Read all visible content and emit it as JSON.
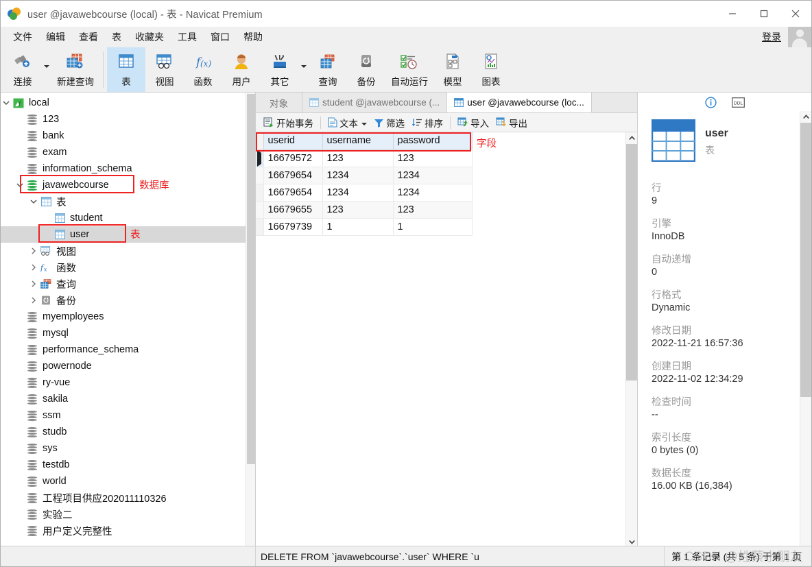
{
  "window": {
    "title": "user @javawebcourse (local) - 表 - Navicat Premium",
    "minimize": "—",
    "maximize": "□",
    "close": "✕"
  },
  "menubar": {
    "items": [
      "文件",
      "编辑",
      "查看",
      "表",
      "收藏夹",
      "工具",
      "窗口",
      "帮助"
    ],
    "login_label": "登录"
  },
  "toolbar": {
    "items": [
      {
        "label": "连接",
        "icon": "connection-icon",
        "has_caret": true,
        "active": false
      },
      {
        "label": "新建查询",
        "icon": "new-query-icon",
        "has_caret": false,
        "active": false
      },
      {
        "label": "表",
        "icon": "table-icon",
        "has_caret": false,
        "active": true
      },
      {
        "label": "视图",
        "icon": "view-icon",
        "has_caret": false,
        "active": false
      },
      {
        "label": "函数",
        "icon": "function-icon",
        "has_caret": false,
        "active": false
      },
      {
        "label": "用户",
        "icon": "user-icon",
        "has_caret": false,
        "active": false
      },
      {
        "label": "其它",
        "icon": "other-icon",
        "has_caret": true,
        "active": false
      },
      {
        "label": "查询",
        "icon": "query-icon",
        "has_caret": false,
        "active": false
      },
      {
        "label": "备份",
        "icon": "backup-icon",
        "has_caret": false,
        "active": false
      },
      {
        "label": "自动运行",
        "icon": "automation-icon",
        "has_caret": false,
        "active": false
      },
      {
        "label": "模型",
        "icon": "model-icon",
        "has_caret": false,
        "active": false
      },
      {
        "label": "图表",
        "icon": "chart-icon",
        "has_caret": false,
        "active": false
      }
    ]
  },
  "sidebar": {
    "tree": [
      {
        "label": "local",
        "icon": "mysql-connection-icon",
        "indent": 0,
        "twisty": "down",
        "selected": false
      },
      {
        "label": "123",
        "icon": "database-icon",
        "indent": 1,
        "twisty": "none",
        "selected": false
      },
      {
        "label": "bank",
        "icon": "database-icon",
        "indent": 1,
        "twisty": "none",
        "selected": false
      },
      {
        "label": "exam",
        "icon": "database-icon",
        "indent": 1,
        "twisty": "none",
        "selected": false
      },
      {
        "label": "information_schema",
        "icon": "database-icon",
        "indent": 1,
        "twisty": "none",
        "selected": false
      },
      {
        "label": "javawebcourse",
        "icon": "database-active-icon",
        "indent": 1,
        "twisty": "down",
        "selected": false
      },
      {
        "label": "表",
        "icon": "tables-folder-icon",
        "indent": 2,
        "twisty": "down",
        "selected": false
      },
      {
        "label": "student",
        "icon": "table-item-icon",
        "indent": 3,
        "twisty": "none",
        "selected": false
      },
      {
        "label": "user",
        "icon": "table-item-icon",
        "indent": 3,
        "twisty": "none",
        "selected": true
      },
      {
        "label": "视图",
        "icon": "views-folder-icon",
        "indent": 2,
        "twisty": "right",
        "selected": false
      },
      {
        "label": "函数",
        "icon": "functions-folder-icon",
        "indent": 2,
        "twisty": "right",
        "selected": false
      },
      {
        "label": "查询",
        "icon": "queries-folder-icon",
        "indent": 2,
        "twisty": "right",
        "selected": false
      },
      {
        "label": "备份",
        "icon": "backups-folder-icon",
        "indent": 2,
        "twisty": "right",
        "selected": false
      },
      {
        "label": "myemployees",
        "icon": "database-icon",
        "indent": 1,
        "twisty": "none",
        "selected": false
      },
      {
        "label": "mysql",
        "icon": "database-icon",
        "indent": 1,
        "twisty": "none",
        "selected": false
      },
      {
        "label": "performance_schema",
        "icon": "database-icon",
        "indent": 1,
        "twisty": "none",
        "selected": false
      },
      {
        "label": "powernode",
        "icon": "database-icon",
        "indent": 1,
        "twisty": "none",
        "selected": false
      },
      {
        "label": "ry-vue",
        "icon": "database-icon",
        "indent": 1,
        "twisty": "none",
        "selected": false
      },
      {
        "label": "sakila",
        "icon": "database-icon",
        "indent": 1,
        "twisty": "none",
        "selected": false
      },
      {
        "label": "ssm",
        "icon": "database-icon",
        "indent": 1,
        "twisty": "none",
        "selected": false
      },
      {
        "label": "studb",
        "icon": "database-icon",
        "indent": 1,
        "twisty": "none",
        "selected": false
      },
      {
        "label": "sys",
        "icon": "database-icon",
        "indent": 1,
        "twisty": "none",
        "selected": false
      },
      {
        "label": "testdb",
        "icon": "database-icon",
        "indent": 1,
        "twisty": "none",
        "selected": false
      },
      {
        "label": "world",
        "icon": "database-icon",
        "indent": 1,
        "twisty": "none",
        "selected": false
      },
      {
        "label": "工程项目供应202011110326",
        "icon": "database-icon",
        "indent": 1,
        "twisty": "none",
        "selected": false
      },
      {
        "label": "实验二",
        "icon": "database-icon",
        "indent": 1,
        "twisty": "none",
        "selected": false
      },
      {
        "label": "用户定义完整性",
        "icon": "database-icon",
        "indent": 1,
        "twisty": "none",
        "selected": false
      }
    ]
  },
  "annotations": [
    {
      "name": "database-annotation",
      "text": "数据库"
    },
    {
      "name": "table-annotation",
      "text": "表"
    },
    {
      "name": "field-annotation",
      "text": "字段"
    }
  ],
  "tabs": [
    {
      "label": "对象",
      "icon": "none",
      "active": false
    },
    {
      "label": "student @javawebcourse (...",
      "icon": "table-item-icon",
      "active": false
    },
    {
      "label": "user @javawebcourse (loc...",
      "icon": "table-item-icon",
      "active": true
    }
  ],
  "subtoolbar": {
    "items": [
      {
        "label": "开始事务",
        "icon": "transaction-icon",
        "caret": false
      },
      {
        "label": "文本",
        "icon": "text-icon",
        "caret": true
      },
      {
        "label": "筛选",
        "icon": "filter-icon",
        "caret": false
      },
      {
        "label": "排序",
        "icon": "sort-icon",
        "caret": false
      },
      {
        "label": "导入",
        "icon": "import-icon",
        "caret": false
      },
      {
        "label": "导出",
        "icon": "export-icon",
        "caret": false
      }
    ]
  },
  "grid": {
    "columns": [
      "userid",
      "username",
      "password"
    ],
    "rows": [
      [
        "16679572",
        "123",
        "123"
      ],
      [
        "16679654",
        "1234",
        "1234"
      ],
      [
        "16679654",
        "1234",
        "1234"
      ],
      [
        "16679655",
        "123",
        "123"
      ],
      [
        "16679739",
        "1",
        "1"
      ]
    ],
    "current_row_index": 0
  },
  "navbar": {
    "buttons": [
      "+",
      "−",
      "✓",
      "✕",
      "⟳",
      "■"
    ],
    "page_value": "1",
    "nav_first": "⇤",
    "nav_prev": "←",
    "nav_next": "→",
    "nav_last": "⇥",
    "settings": "⚙"
  },
  "infopanel": {
    "tab_info": "info-icon",
    "tab_ddl": "ddl-icon",
    "object_name": "user",
    "object_type": "表",
    "fields": [
      {
        "label": "行",
        "value": "9"
      },
      {
        "label": "引擎",
        "value": "InnoDB"
      },
      {
        "label": "自动递增",
        "value": "0"
      },
      {
        "label": "行格式",
        "value": "Dynamic"
      },
      {
        "label": "修改日期",
        "value": "2022-11-21 16:57:36"
      },
      {
        "label": "创建日期",
        "value": "2022-11-02 12:34:29"
      },
      {
        "label": "检查时间",
        "value": "--"
      },
      {
        "label": "索引长度",
        "value": "0 bytes (0)"
      },
      {
        "label": "数据长度",
        "value": "16.00 KB (16,384)"
      }
    ]
  },
  "statusbar": {
    "sql": "DELETE FROM `javawebcourse`.`user` WHERE `u",
    "record_info": "第 1 条记录 (共 5 条) 于第 1 页"
  },
  "watermark": "CSDN @姓蔡小朋友",
  "colors": {
    "accent": "#2f78c4",
    "selection": "#d8d8d8",
    "header_bg": "#e5eff9",
    "annotation": "#ee2222",
    "toolbar_bg": "#f0f0f0"
  }
}
